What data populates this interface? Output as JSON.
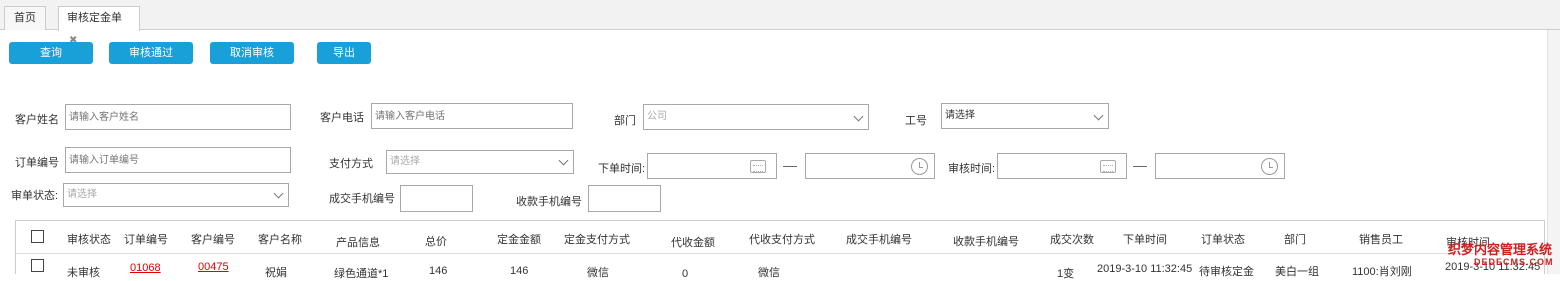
{
  "tabs": {
    "home": "首页",
    "active": "审核定金单",
    "close": "✖"
  },
  "toolbar": {
    "query": "查询",
    "approve": "审核通过",
    "cancel_approve": "取消审核",
    "export": "导出"
  },
  "filters": {
    "customer_name": {
      "label": "客户姓名",
      "placeholder": "请输入客户姓名"
    },
    "customer_phone": {
      "label": "客户电话",
      "placeholder": "请输入客户电话"
    },
    "department": {
      "label": "部门",
      "value": "公司"
    },
    "job_no": {
      "label": "工号",
      "value": "请选择"
    },
    "order_no": {
      "label": "订单编号",
      "placeholder": "请输入订单编号"
    },
    "pay_method": {
      "label": "支付方式",
      "value": "请选择"
    },
    "order_time": {
      "label": "下单时间:"
    },
    "audit_time": {
      "label": "审核时间:"
    },
    "audit_status": {
      "label": "审单状态:",
      "value": "请选择"
    },
    "deal_phone": {
      "label": "成交手机编号"
    },
    "pay_phone": {
      "label": "收款手机编号"
    }
  },
  "table": {
    "headers": [
      "审核状态",
      "订单编号",
      "客户编号",
      "客户名称",
      "产品信息",
      "总价",
      "定金金额",
      "定金支付方式",
      "代收金额",
      "代收支付方式",
      "成交手机编号",
      "收款手机编号",
      "成交次数",
      "下单时间",
      "订单状态",
      "部门",
      "销售员工",
      "审核时间"
    ],
    "row": {
      "status": "未审核",
      "order_no": "01068",
      "customer_no": "00475",
      "customer_name": "祝娟",
      "product": "绿色通道*1",
      "total": "146",
      "deposit": "146",
      "deposit_method": "微信",
      "collect_amount": "0",
      "collect_method": "微信",
      "deal_count": "1变",
      "order_time": "2019-3-10 11:32:45",
      "order_status": "待审核定金",
      "department": "美白一组",
      "sales": "1100:肖刘刚",
      "audit_time": "2019-3-10 11:32:45"
    }
  },
  "watermark": {
    "line1": "织梦内容管理系统",
    "line2": "DEDECMS.COM"
  },
  "colors": {
    "accent": "#1aa0d8",
    "link": "#e00000",
    "watermark": "#cc2222"
  }
}
